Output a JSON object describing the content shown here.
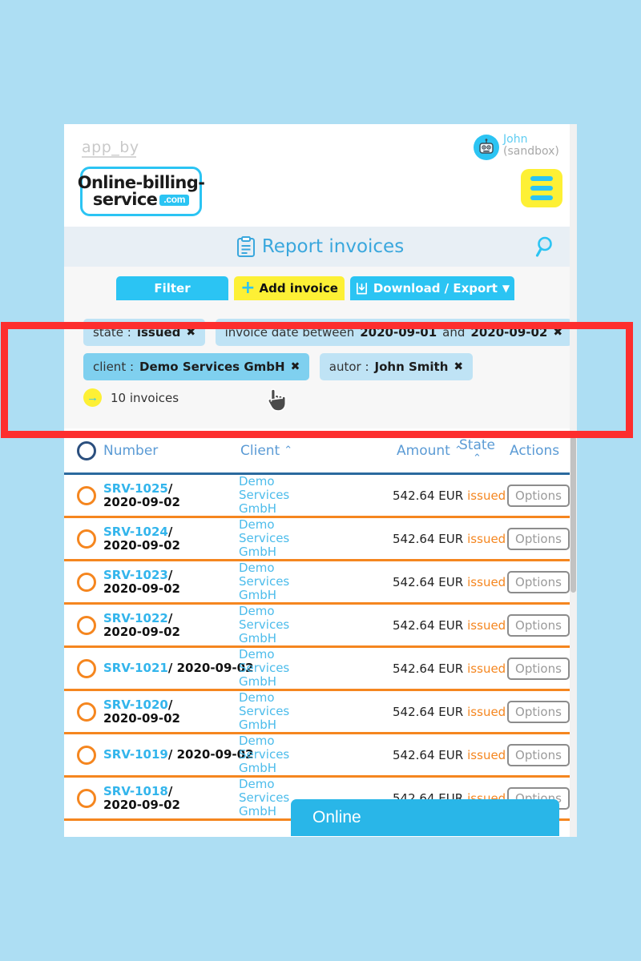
{
  "branding": {
    "app_by": "app_by",
    "logo_line1": "Online-billing-",
    "logo_line2": "service",
    "logo_tld": ".com"
  },
  "user": {
    "name": "John",
    "environment": "(sandbox)",
    "avatar_icon": "robot-avatar-icon",
    "menu_icon": "hamburger-menu-icon"
  },
  "page": {
    "title": "Report invoices",
    "title_icon": "clipboard-icon",
    "search_icon": "search-icon"
  },
  "toolbar": {
    "filter_label": "Filter",
    "add_invoice_label": "Add invoice",
    "add_invoice_icon": "plus-icon",
    "download_export_label": "Download / Export",
    "download_icon": "download-icon",
    "download_caret": "⌄"
  },
  "filters": {
    "chips": [
      {
        "label": "state : ",
        "value": "issued",
        "remove_icon": "✖",
        "hovered": false
      },
      {
        "label": "invoice date between ",
        "value": "2020-09-01",
        "label2": " and ",
        "value2": "2020-09-02",
        "remove_icon": "✖",
        "hovered": false
      },
      {
        "label": "client : ",
        "value": "Demo Services GmbH",
        "remove_icon": "✖",
        "hovered": true
      },
      {
        "label": "autor : ",
        "value": "John Smith",
        "remove_icon": "✖",
        "hovered": false
      }
    ],
    "result_count": "10 invoices",
    "result_icon": "→"
  },
  "table": {
    "headers": {
      "select_all_icon": "select-all-circle-icon",
      "number": "Number",
      "client": "Client",
      "amount": "Amount",
      "state": "State",
      "actions": "Actions",
      "sort_caret": "⌃"
    },
    "rows": [
      {
        "number": "SRV-1025",
        "sep": "/",
        "date": "2020-09-02",
        "client_line1": "Demo Services",
        "client_line2": "GmbH",
        "amount": "542.64 EUR",
        "state": "issued",
        "options": "Options",
        "wrap": "two-line"
      },
      {
        "number": "SRV-1024",
        "sep": "/",
        "date": "2020-09-02",
        "client_line1": "Demo Services",
        "client_line2": "GmbH",
        "amount": "542.64 EUR",
        "state": "issued",
        "options": "Options",
        "wrap": "two-line"
      },
      {
        "number": "SRV-1023",
        "sep": "/",
        "date": "2020-09-02",
        "client_line1": "Demo Services",
        "client_line2": "GmbH",
        "amount": "542.64 EUR",
        "state": "issued",
        "options": "Options",
        "wrap": "two-line"
      },
      {
        "number": "SRV-1022",
        "sep": "/",
        "date": "2020-09-02",
        "client_line1": "Demo Services",
        "client_line2": "GmbH",
        "amount": "542.64 EUR",
        "state": "issued",
        "options": "Options",
        "wrap": "two-line"
      },
      {
        "number": "SRV-1021",
        "sep": "/",
        "date": "2020-09-02",
        "client_line1": "Demo Services",
        "client_line2": "GmbH",
        "amount": "542.64 EUR",
        "state": "issued",
        "options": "Options",
        "wrap": "one-line"
      },
      {
        "number": "SRV-1020",
        "sep": "/",
        "date": "2020-09-02",
        "client_line1": "Demo Services",
        "client_line2": "GmbH",
        "amount": "542.64 EUR",
        "state": "issued",
        "options": "Options",
        "wrap": "two-line"
      },
      {
        "number": "SRV-1019",
        "sep": "/",
        "date": "2020-09-02",
        "client_line1": "Demo Services",
        "client_line2": "GmbH",
        "amount": "542.64 EUR",
        "state": "issued",
        "options": "Options",
        "wrap": "one-line"
      },
      {
        "number": "SRV-1018",
        "sep": "/",
        "date": "2020-09-02",
        "client_line1": "Demo Services",
        "client_line2": "GmbH",
        "amount": "542.64 EUR",
        "state": "issued",
        "options": "Options",
        "wrap": "two-line"
      }
    ]
  },
  "chat_widget": {
    "label": "Online"
  },
  "colors": {
    "page_background": "#addef3",
    "brand_blue": "#2bc4f3",
    "brand_yellow": "#fdf035",
    "accent_orange": "#f5861f",
    "chip_blue": "#bfe3f5",
    "chip_blue_hover": "#7fd0ef",
    "header_blue": "#5b9bd5",
    "annotation_red": "#fd2e2e",
    "chat_blue": "#29b6e8"
  }
}
